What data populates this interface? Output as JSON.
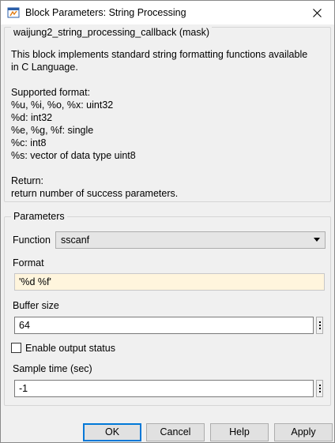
{
  "window": {
    "title": "Block Parameters: String Processing"
  },
  "mask": {
    "legend": "waijung2_string_processing_callback (mask)",
    "description_lines": [
      "This block implements standard string formatting functions available",
      "in C Language.",
      "",
      "Supported format:",
      "%u, %i, %o, %x: uint32",
      "%d: int32",
      "%e, %g, %f: single",
      "%c: int8",
      "%s: vector of data type uint8",
      "",
      "Return:",
      "return number of success parameters."
    ]
  },
  "parameters": {
    "legend": "Parameters",
    "function_label": "Function",
    "function_value": "sscanf",
    "format_label": "Format",
    "format_value": "'%d %f'",
    "buffer_size_label": "Buffer size",
    "buffer_size_value": "64",
    "enable_output_status_label": "Enable output status",
    "enable_output_status_checked": false,
    "sample_time_label": "Sample time (sec)",
    "sample_time_value": "-1"
  },
  "buttons": {
    "ok": "OK",
    "cancel": "Cancel",
    "help": "Help",
    "apply": "Apply"
  },
  "colors": {
    "accent": "#0078d7",
    "highlight_field": "#fff5dd",
    "window_bg": "#f0f0f0"
  },
  "icons": {
    "app": "simulink-block-icon",
    "close": "close-icon",
    "dropdown": "chevron-down-icon",
    "more": "vertical-ellipsis-icon"
  }
}
